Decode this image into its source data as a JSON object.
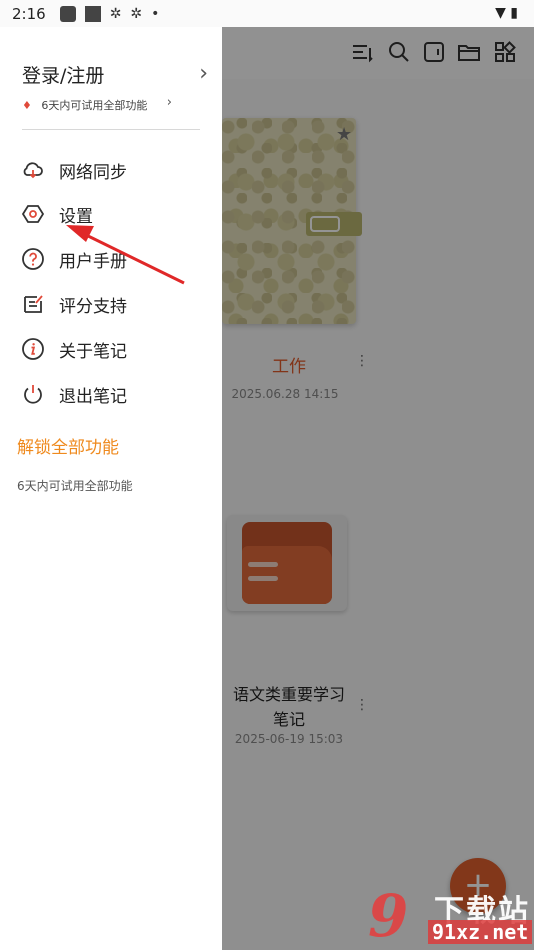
{
  "status_bar": {
    "time": "2:16",
    "dot": "•"
  },
  "drawer": {
    "login": {
      "label": "登录/注册",
      "chevron": "›"
    },
    "trial": {
      "text": "6天内可试用全部功能",
      "chevron": "›"
    },
    "menu": [
      {
        "label": "网络同步",
        "icon": "cloud-sync-icon"
      },
      {
        "label": "设置",
        "icon": "settings-icon"
      },
      {
        "label": "用户手册",
        "icon": "help-icon"
      },
      {
        "label": "评分支持",
        "icon": "rate-icon"
      },
      {
        "label": "关于笔记",
        "icon": "info-icon"
      },
      {
        "label": "退出笔记",
        "icon": "power-icon"
      }
    ],
    "unlock": {
      "title": "解锁全部功能",
      "subtitle": "6天内可试用全部功能"
    }
  },
  "notes": [
    {
      "title": "工作",
      "date": "2025.06.28 14:15"
    },
    {
      "title": "语文类重要学习笔记",
      "date": "2025-06-19 15:03"
    }
  ],
  "fab": {
    "label": "+"
  },
  "watermark": {
    "top": "下载站",
    "bottom": "91xz.net"
  },
  "colors": {
    "accent": "#e0602e",
    "unlock": "#ef8a1e",
    "annotation_arrow": "#e02828",
    "note_title": "#e05a2a"
  }
}
